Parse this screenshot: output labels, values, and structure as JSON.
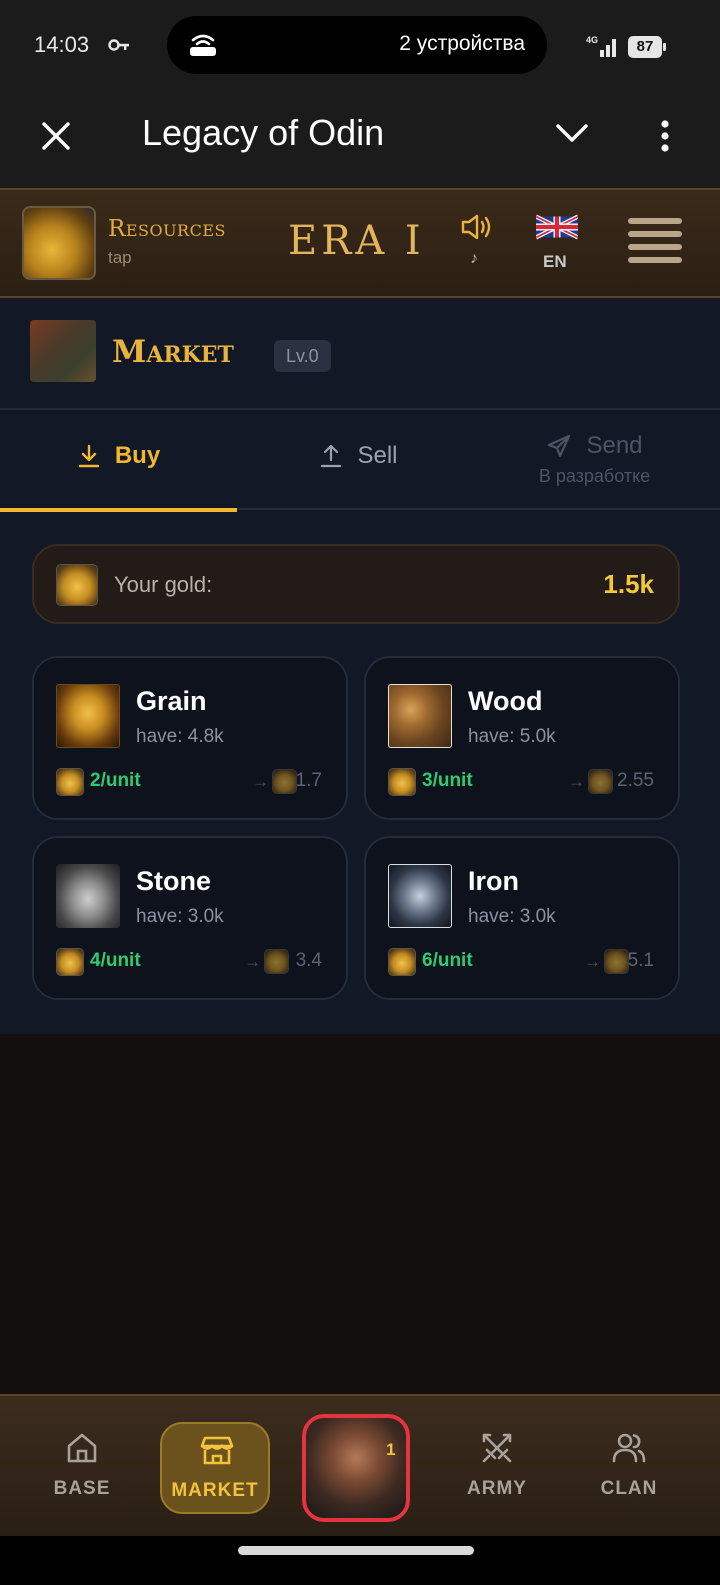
{
  "status_bar": {
    "time": "14:03",
    "island_text": "2 устройства",
    "network": "4G",
    "battery": "87"
  },
  "app_header": {
    "title": "Legacy of Odin"
  },
  "game_bar": {
    "resources_title": "Resources",
    "resources_sub": "tap",
    "era": "ERA I",
    "sound_sub": "♪",
    "language": "EN"
  },
  "market": {
    "title": "Market",
    "level": "Lv.0"
  },
  "tabs": [
    {
      "label": "Buy",
      "icon": "download-icon"
    },
    {
      "label": "Sell",
      "icon": "upload-icon"
    },
    {
      "label": "Send",
      "note": "В разработке",
      "icon": "send-icon"
    }
  ],
  "gold": {
    "label": "Your gold:",
    "value": "1.5k"
  },
  "resources": [
    {
      "name": "Grain",
      "have": "have: 4.8k",
      "price": "2/unit",
      "arrow": "→",
      "sell": "1.7",
      "icon": "grain-icon"
    },
    {
      "name": "Wood",
      "have": "have: 5.0k",
      "price": "3/unit",
      "arrow": "→",
      "sell": "2.55",
      "icon": "wood-icon"
    },
    {
      "name": "Stone",
      "have": "have: 3.0k",
      "price": "4/unit",
      "arrow": "→",
      "sell": "3.4",
      "icon": "stone-icon"
    },
    {
      "name": "Iron",
      "have": "have: 3.0k",
      "price": "6/unit",
      "arrow": "→",
      "sell": "5.1",
      "icon": "iron-icon"
    }
  ],
  "nav": {
    "base": "BASE",
    "market": "MARKET",
    "hero_badge": "1",
    "army": "ARMY",
    "clan": "CLAN"
  },
  "colors": {
    "accent_gold": "#f0b72f",
    "price_green": "#2ecc71",
    "hero_border": "#e4343f"
  }
}
